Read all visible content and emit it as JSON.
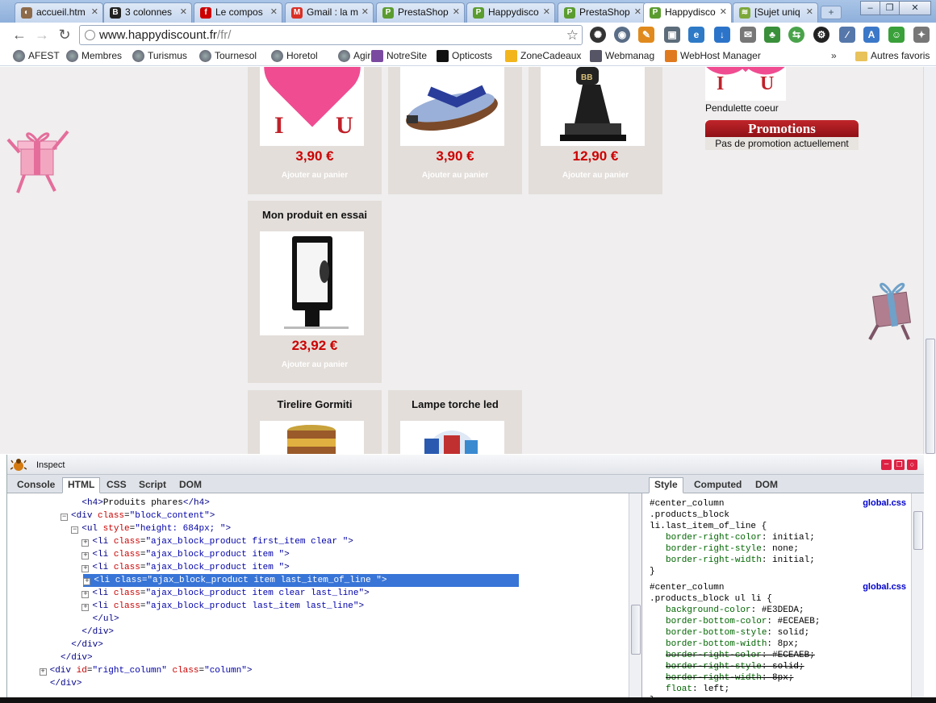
{
  "tabs": [
    {
      "title": "accueil.htm",
      "icon": "globe-icon",
      "color": "#8d6a4a"
    },
    {
      "title": "3 colonnes",
      "icon": "b-logo-icon",
      "color": "#222222"
    },
    {
      "title": "Le compos",
      "icon": "free-logo-icon",
      "color": "#cc0000"
    },
    {
      "title": "Gmail : la m",
      "icon": "gmail-icon",
      "color": "#d93025"
    },
    {
      "title": "PrestaShop",
      "icon": "prestashop-icon",
      "color": "#5b9c2f"
    },
    {
      "title": "Happydisco",
      "icon": "prestashop-icon",
      "color": "#5b9c2f"
    },
    {
      "title": "PrestaShop",
      "icon": "prestashop-icon",
      "color": "#5b9c2f"
    },
    {
      "title": "Happydisco",
      "icon": "prestashop-icon",
      "color": "#5b9c2f"
    },
    {
      "title": "[Sujet uniq",
      "icon": "forum-icon",
      "color": "#7ca83a"
    }
  ],
  "address": {
    "domain": "www.happydiscount.fr",
    "path": "/fr/"
  },
  "bookmarks": [
    "AFEST",
    "Membres",
    "Turismus",
    "Tournesol",
    "Horetol",
    "Agir",
    "NotreSite",
    "Opticosts",
    "ZoneCadeaux",
    "Webmanag",
    "WebHost Manager"
  ],
  "bookmarks_other": "Autres favoris",
  "products": {
    "row1": [
      {
        "price": "3,90 €",
        "cart": "Ajouter au panier"
      },
      {
        "price": "3,90 €",
        "cart": "Ajouter au panier"
      },
      {
        "price": "12,90 €",
        "cart": "Ajouter au panier"
      }
    ],
    "essai": {
      "title": "Mon produit en essai",
      "price": "23,92 €",
      "cart": "Ajouter au panier"
    },
    "tirelire": {
      "title": "Tirelire Gormiti"
    },
    "lampe": {
      "title": "Lampe torche led"
    }
  },
  "sidebar": {
    "pendulette": "Pendulette coeur",
    "promo_title": "Promotions",
    "promo_text": "Pas de promotion actuellement"
  },
  "firebug": {
    "title": "Inspect",
    "tabs": [
      "Console",
      "HTML",
      "CSS",
      "Script",
      "DOM"
    ],
    "side_tabs": [
      "Style",
      "Computed",
      "DOM"
    ],
    "active_tab": "HTML",
    "active_side_tab": "Style",
    "html_lines": [
      {
        "indent": "            ",
        "twist": "",
        "parts": [
          [
            "tg",
            "<h4>"
          ],
          [
            "tx",
            "Produits phares"
          ],
          [
            "tg",
            "</h4>"
          ]
        ]
      },
      {
        "indent": "          ",
        "twist": "-",
        "parts": [
          [
            "tg",
            "<div "
          ],
          [
            "an",
            "class"
          ],
          [
            "tx",
            "="
          ],
          [
            "av",
            "\"block_content\""
          ],
          [
            "tg",
            ">"
          ]
        ]
      },
      {
        "indent": "            ",
        "twist": "-",
        "parts": [
          [
            "tg",
            "<ul "
          ],
          [
            "an",
            "style"
          ],
          [
            "tx",
            "="
          ],
          [
            "av",
            "\"height: 684px; \""
          ],
          [
            "tg",
            ">"
          ]
        ]
      },
      {
        "indent": "              ",
        "twist": "+",
        "parts": [
          [
            "tg",
            "<li "
          ],
          [
            "an",
            "class"
          ],
          [
            "tx",
            "="
          ],
          [
            "av",
            "\"ajax_block_product first_item clear \""
          ],
          [
            "tg",
            ">"
          ]
        ]
      },
      {
        "indent": "              ",
        "twist": "+",
        "parts": [
          [
            "tg",
            "<li "
          ],
          [
            "an",
            "class"
          ],
          [
            "tx",
            "="
          ],
          [
            "av",
            "\"ajax_block_product item \""
          ],
          [
            "tg",
            ">"
          ]
        ]
      },
      {
        "indent": "              ",
        "twist": "+",
        "parts": [
          [
            "tg",
            "<li "
          ],
          [
            "an",
            "class"
          ],
          [
            "tx",
            "="
          ],
          [
            "av",
            "\"ajax_block_product item \""
          ],
          [
            "tg",
            ">"
          ]
        ]
      },
      {
        "indent": "              ",
        "twist": "+",
        "parts": [
          [
            "tg",
            "<li "
          ],
          [
            "an",
            "class"
          ],
          [
            "tx",
            "="
          ],
          [
            "av",
            "\"ajax_block_product item last_item_of_line \""
          ],
          [
            "tg",
            ">"
          ]
        ],
        "selected": true
      },
      {
        "indent": "              ",
        "twist": "+",
        "parts": [
          [
            "tg",
            "<li "
          ],
          [
            "an",
            "class"
          ],
          [
            "tx",
            "="
          ],
          [
            "av",
            "\"ajax_block_product item clear last_line\""
          ],
          [
            "tg",
            ">"
          ]
        ]
      },
      {
        "indent": "              ",
        "twist": "+",
        "parts": [
          [
            "tg",
            "<li "
          ],
          [
            "an",
            "class"
          ],
          [
            "tx",
            "="
          ],
          [
            "av",
            "\"ajax_block_product last_item last_line\""
          ],
          [
            "tg",
            ">"
          ]
        ]
      },
      {
        "indent": "              ",
        "twist": "",
        "parts": [
          [
            "tg",
            "</ul>"
          ]
        ]
      },
      {
        "indent": "            ",
        "twist": "",
        "parts": [
          [
            "tg",
            "</div>"
          ]
        ]
      },
      {
        "indent": "          ",
        "twist": "",
        "parts": [
          [
            "tg",
            "</div>"
          ]
        ]
      },
      {
        "indent": "        ",
        "twist": "",
        "parts": [
          [
            "tg",
            "</div>"
          ]
        ]
      },
      {
        "indent": "      ",
        "twist": "+",
        "parts": [
          [
            "tg",
            "<div "
          ],
          [
            "an",
            "id"
          ],
          [
            "tx",
            "="
          ],
          [
            "av",
            "\"right_column\""
          ],
          [
            "tx",
            " "
          ],
          [
            "an",
            "class"
          ],
          [
            "tx",
            "="
          ],
          [
            "av",
            "\"column\""
          ],
          [
            "tg",
            ">"
          ]
        ]
      },
      {
        "indent": "      ",
        "twist": "",
        "parts": [
          [
            "tg",
            "</div>"
          ]
        ]
      }
    ],
    "css_rules": [
      {
        "source": "global.css",
        "selector": [
          "#center_column",
          ".products_block",
          "li.last_item_of_line {"
        ],
        "props": [
          [
            "border-right-color",
            "initial;",
            false
          ],
          [
            "border-right-style",
            "none;",
            false
          ],
          [
            "border-right-width",
            "initial;",
            false
          ]
        ]
      },
      {
        "source": "global.css",
        "selector": [
          "#center_column",
          ".products_block ul li {"
        ],
        "props": [
          [
            "background-color",
            "#E3DEDA;",
            false
          ],
          [
            "border-bottom-color",
            "#ECEAEB;",
            false
          ],
          [
            "border-bottom-style",
            "solid;",
            false
          ],
          [
            "border-bottom-width",
            "8px;",
            false
          ],
          [
            "border-right-color",
            "#ECEAEB;",
            true
          ],
          [
            "border-right-style",
            "solid;",
            true
          ],
          [
            "border-right-width",
            "8px;",
            true
          ],
          [
            "float",
            "left;",
            false
          ]
        ]
      }
    ]
  },
  "colors": {
    "accent_selected": "#3875d7",
    "price": "#cc0000",
    "promo": "#b01c21"
  }
}
